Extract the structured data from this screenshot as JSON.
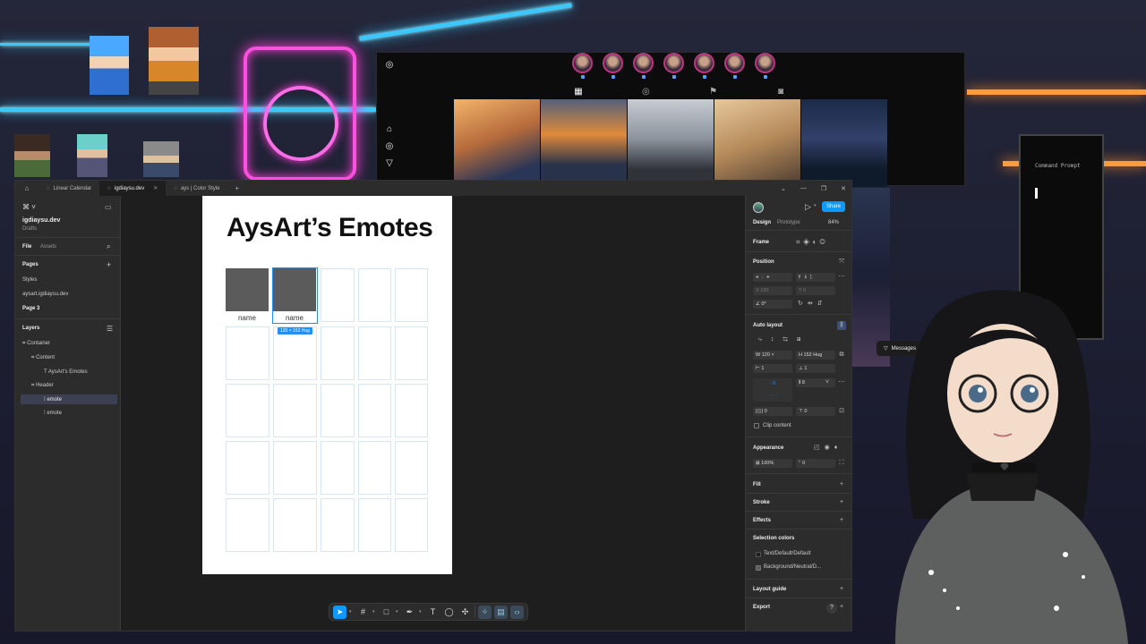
{
  "instagram": {
    "side_icons": [
      "instagram-icon",
      "home-icon",
      "instagram-icon",
      "send-icon"
    ],
    "stories": [
      1,
      2,
      3,
      4,
      5,
      6,
      7
    ],
    "tabs": [
      "▦",
      "◎",
      "⚑",
      "◙"
    ],
    "posts": [
      {
        "bg": "linear-gradient(160deg,#f3b36a,#b56b3c 45%,#2a3657 80%)"
      },
      {
        "bg": "linear-gradient(180deg,#54607a,#e08a3a 40%,#28324a 75%)"
      },
      {
        "bg": "linear-gradient(180deg,#c8ccd3,#8b939c 45%,#30343a 80%)"
      },
      {
        "bg": "linear-gradient(160deg,#e7c79a,#b58a5a 50%,#4a3a30)"
      },
      {
        "bg": "linear-gradient(180deg,#1b2a48,#33406a 45%,#0f1a2a 80%)"
      }
    ]
  },
  "figma": {
    "titlebar": {
      "tabs": [
        {
          "label": "Linear Calendar",
          "active": false
        },
        {
          "label": "igdiaysu.dev",
          "active": true
        },
        {
          "label": "ays | Color Style",
          "active": false
        }
      ],
      "close": "✕",
      "plus": "+",
      "controls": [
        "⌄",
        "—",
        "❐",
        "✕"
      ]
    },
    "left": {
      "file_name": "igdiaysu.dev",
      "file_location": "Drafts",
      "tab_file": "File",
      "tab_assets": "Assets",
      "pages_header": "Pages",
      "pages": [
        "Styles",
        "aysart.igdiaysu.dev",
        "Page 3"
      ],
      "layers_header": "Layers",
      "layers": [
        "Container",
        "Content",
        "AysArt's Emotes",
        "Header",
        "emote",
        "emote"
      ]
    },
    "canvas": {
      "title": "AysArt’s Emotes",
      "emote_name_1": "name",
      "emote_name_2": "name",
      "size_badge": "120 × 152 Hug"
    },
    "right": {
      "tab_design": "Design",
      "tab_prototype": "Prototype",
      "zoom": "84%",
      "share": "Share",
      "frame_label": "Frame",
      "position": "Position",
      "x_label": "X",
      "x_value": "130",
      "y_label": "Y",
      "y_value": "0",
      "rotation": "0°",
      "auto_layout": "Auto layout",
      "w_label": "W",
      "w_value": "120",
      "h_label": "H",
      "h_value": "152",
      "h_mode": "Hug",
      "gap_h": "1",
      "gap_v": "1",
      "spacing": "8",
      "pad_h": "0",
      "pad_v": "0",
      "clip_content": "Clip content",
      "appearance": "Appearance",
      "opacity": "100%",
      "radius": "0",
      "fill": "Fill",
      "stroke": "Stroke",
      "effects": "Effects",
      "selection_colors": "Selection colors",
      "colors": [
        {
          "name": "Text/Default/Default",
          "hex": "#1e1e1e"
        },
        {
          "name": "Background/Neutral/D...",
          "hex": "#5b5b5b"
        }
      ],
      "layout_guide": "Layout guide",
      "export": "Export",
      "help": "?"
    },
    "toolbar": {
      "tools": [
        "move-tool",
        "frame-tool",
        "shape-tool",
        "pen-tool",
        "text-tool",
        "comment-tool",
        "components-tool",
        "ui3-tool",
        "actions-tool",
        "dev-mode-toggle"
      ]
    }
  },
  "terminal": {
    "title": "Command Prompt"
  },
  "messages": {
    "label": "Messages"
  }
}
